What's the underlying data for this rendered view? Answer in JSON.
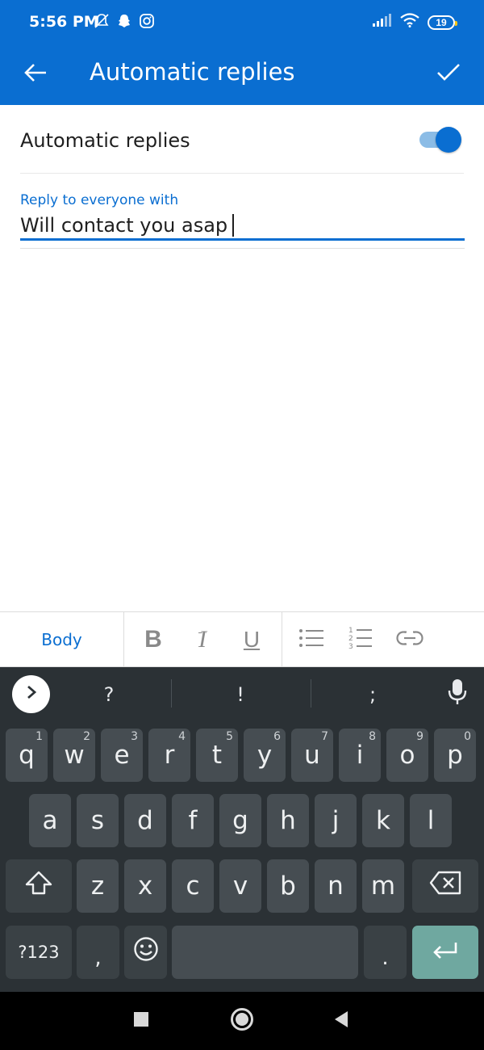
{
  "status_bar": {
    "time": "5:56 PM",
    "battery": "19",
    "icons": [
      "bell-off-icon",
      "snapchat-icon",
      "instagram-icon",
      "signal-icon",
      "wifi-icon",
      "battery-icon"
    ]
  },
  "app_bar": {
    "title": "Automatic replies",
    "back_icon": "arrow-left-icon",
    "confirm_icon": "check-icon"
  },
  "settings": {
    "toggle_label": "Automatic replies",
    "toggle_on": true
  },
  "reply_field": {
    "label": "Reply to everyone with",
    "value": "Will contact you asap"
  },
  "format_toolbar": {
    "style_label": "Body",
    "bold": "B",
    "italic": "I",
    "underline": "U",
    "icons": [
      "bullet-list-icon",
      "numbered-list-icon",
      "link-icon"
    ]
  },
  "keyboard": {
    "suggestions": [
      "?",
      "!",
      ";"
    ],
    "row1": [
      {
        "k": "q",
        "h": "1"
      },
      {
        "k": "w",
        "h": "2"
      },
      {
        "k": "e",
        "h": "3"
      },
      {
        "k": "r",
        "h": "4"
      },
      {
        "k": "t",
        "h": "5"
      },
      {
        "k": "y",
        "h": "6"
      },
      {
        "k": "u",
        "h": "7"
      },
      {
        "k": "i",
        "h": "8"
      },
      {
        "k": "o",
        "h": "9"
      },
      {
        "k": "p",
        "h": "0"
      }
    ],
    "row2": [
      "a",
      "s",
      "d",
      "f",
      "g",
      "h",
      "j",
      "k",
      "l"
    ],
    "row3": [
      "z",
      "x",
      "c",
      "v",
      "b",
      "n",
      "m"
    ],
    "symbols_key": "?123",
    "comma_key": ",",
    "period_key": ".",
    "colors": {
      "background": "#2b3135",
      "key": "#464d52",
      "enter": "#6fa8a0"
    }
  },
  "colors": {
    "accent": "#0a6ed1",
    "toggle_track": "#8bbce6",
    "text": "#1f1f1f"
  }
}
